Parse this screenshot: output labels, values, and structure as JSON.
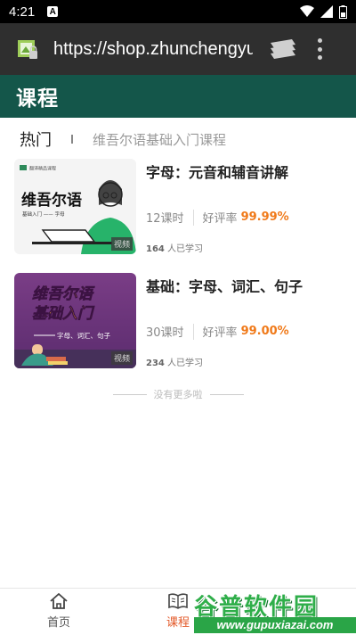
{
  "status_bar": {
    "time": "4:21",
    "notification_letter": "A"
  },
  "browser": {
    "url": "https://shop.zhunchengyu"
  },
  "header": {
    "title": "课程"
  },
  "tabs": {
    "hot": "热门",
    "course_name": "维吾尔语基础入门课程"
  },
  "courses": [
    {
      "title": "字母：元音和辅音讲解",
      "lessons": "12课时",
      "rating_label": "好评率",
      "rating_value": "99.99%",
      "students_count": "164",
      "students_label": " 人已学习",
      "badge": "视频",
      "thumb_text": "维吾尔语",
      "thumb_sub": "基础入门 —— 字母",
      "thumb_logo": "翻译精品课程"
    },
    {
      "title": "基础：字母、词汇、句子",
      "lessons": "30课时",
      "rating_label": "好评率",
      "rating_value": "99.00%",
      "students_count": "234",
      "students_label": " 人已学习",
      "badge": "视频",
      "thumb_text_1": "维吾尔语",
      "thumb_text_2": "基础入门",
      "thumb_sub": "字母、词汇、句子"
    }
  ],
  "end_text": "没有更多啦",
  "bottom_nav": {
    "home": "首页",
    "course": "课程"
  },
  "watermark": {
    "main": "谷普软件园",
    "sub": "www.gupuxiazai.com"
  },
  "colors": {
    "header_bg": "#14564a",
    "accent": "#f07a1a",
    "nav_active": "#e35a2a"
  }
}
